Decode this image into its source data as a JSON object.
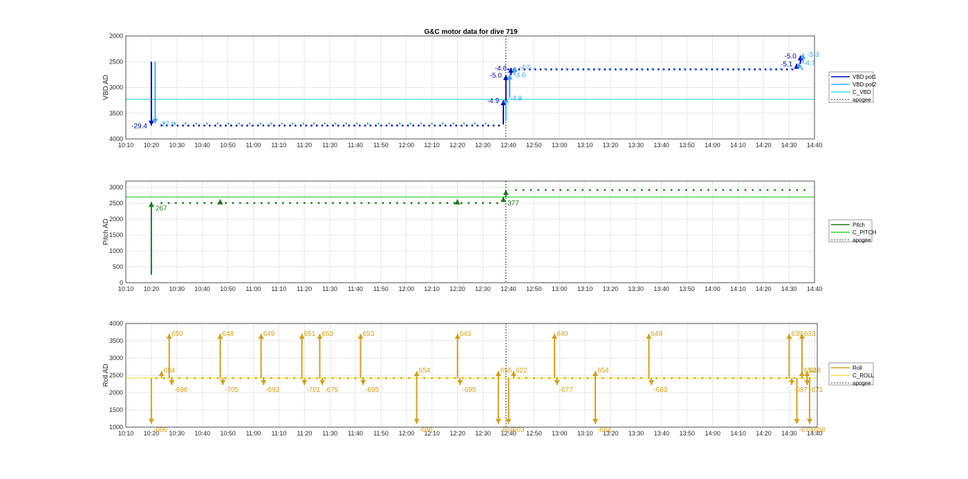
{
  "title": "G&C motor data for dive 719",
  "colors": {
    "vbd_pot1": "#0000c0",
    "vbd_pot2": "#3aa6ff",
    "c_vbd": "#33dddd",
    "pitch": "#1a7a1a",
    "c_pitch": "#33cc33",
    "roll": "#d4a017",
    "c_roll": "#f2e04a",
    "apogee": "#333333",
    "grid": "#e6e6e6",
    "axis": "#262626"
  },
  "chart_data": [
    {
      "type": "scatter",
      "name": "vbd",
      "title": "G&C motor data for dive 719",
      "xlabel": "",
      "ylabel": "VBD AD",
      "y_reversed": true,
      "xlim": [
        "10:10",
        "14:40"
      ],
      "xticks": [
        "10:10",
        "10:20",
        "10:30",
        "10:40",
        "10:50",
        "11:00",
        "11:10",
        "11:20",
        "11:30",
        "11:40",
        "11:50",
        "12:00",
        "12:10",
        "12:20",
        "12:30",
        "12:40",
        "12:50",
        "13:00",
        "13:10",
        "13:20",
        "13:30",
        "13:40",
        "13:50",
        "14:00",
        "14:10",
        "14:20",
        "14:30",
        "14:40"
      ],
      "ylim": [
        2000,
        4000
      ],
      "yticks": [
        "2000",
        "2500",
        "3000",
        "3500",
        "4000"
      ],
      "grid": true,
      "legend_position": "right",
      "legend": [
        "VBD pot1",
        "VBD pot2",
        "C_VBD",
        "apogee"
      ],
      "apogee": "12:39",
      "reference": {
        "name": "C_VBD",
        "value": 3230
      },
      "series": [
        {
          "name": "VBD pot1",
          "pre": {
            "start": "10:24",
            "end": "12:38",
            "step": 2.1,
            "value": 3740
          },
          "post": {
            "start": "12:40",
            "end": "14:32",
            "step": 2.1,
            "value": 2650
          }
        },
        {
          "name": "VBD pot2",
          "pre": {
            "start": "10:25",
            "end": "12:34",
            "step": 4.2,
            "value": 3700
          },
          "post": {
            "start": "12:46",
            "end": "14:36",
            "step": 4.2,
            "value": 2640
          }
        }
      ],
      "moves": [
        {
          "t": "10:20",
          "from": 2500,
          "to": 3740,
          "series": "VBD pot1",
          "label": "-29.4",
          "label_side": "left"
        },
        {
          "t": "10:21.5",
          "from": 2500,
          "to": 3700,
          "series": "VBD pot2",
          "label": "-27.9",
          "label_side": "right"
        },
        {
          "t": "12:38",
          "from": 3720,
          "to": 3250,
          "series": "VBD pot1",
          "label": "-4.9",
          "label_side": "left"
        },
        {
          "t": "12:39",
          "from": 3650,
          "to": 3200,
          "series": "VBD pot2",
          "label": "-4.9",
          "label_side": "right"
        },
        {
          "t": "12:39",
          "from": 3250,
          "to": 2760,
          "series": "VBD pot1",
          "label": "-5.0",
          "label_side": "left"
        },
        {
          "t": "12:40.5",
          "from": 3200,
          "to": 2750,
          "series": "VBD pot2",
          "label": "-4.6",
          "label_side": "right"
        },
        {
          "t": "12:41",
          "from": 2760,
          "to": 2620,
          "series": "VBD pot1",
          "label": "-4.6",
          "label_side": "left"
        },
        {
          "t": "12:42.5",
          "from": 2750,
          "to": 2600,
          "series": "VBD pot2",
          "label": "-4.6",
          "label_side": "right"
        },
        {
          "t": "14:33",
          "from": 2640,
          "to": 2540,
          "series": "VBD pot1",
          "label": "-5.1",
          "label_side": "left"
        },
        {
          "t": "14:34",
          "from": 2600,
          "to": 2520,
          "series": "VBD pot2",
          "label": "-4.7",
          "label_side": "right"
        },
        {
          "t": "14:34.5",
          "from": 2540,
          "to": 2380,
          "series": "VBD pot1",
          "label": "-5.0",
          "label_side": "left"
        },
        {
          "t": "14:35.5",
          "from": 2520,
          "to": 2350,
          "series": "VBD pot2",
          "label": "-5.3",
          "label_side": "right"
        }
      ]
    },
    {
      "type": "scatter",
      "name": "pitch",
      "xlabel": "",
      "ylabel": "Pitch AD",
      "xlim": [
        "10:10",
        "14:40"
      ],
      "xticks": [
        "10:10",
        "10:20",
        "10:30",
        "10:40",
        "10:50",
        "11:00",
        "11:10",
        "11:20",
        "11:30",
        "11:40",
        "11:50",
        "12:00",
        "12:10",
        "12:20",
        "12:30",
        "12:40",
        "12:50",
        "13:00",
        "13:10",
        "13:20",
        "13:30",
        "13:40",
        "13:50",
        "14:00",
        "14:10",
        "14:20",
        "14:30",
        "14:40"
      ],
      "ylim": [
        0,
        3200
      ],
      "yticks": [
        "0",
        "500",
        "1000",
        "1500",
        "2000",
        "2500",
        "3000"
      ],
      "grid": true,
      "legend_position": "right",
      "legend": [
        "Pitch",
        "C_PITCH",
        "apogee"
      ],
      "apogee": "12:39",
      "reference": {
        "name": "C_PITCH",
        "value": 2700
      },
      "series": [
        {
          "name": "Pitch",
          "pre": {
            "start": "10:24",
            "end": "12:36",
            "step": 2.8,
            "value": 2510
          },
          "post": {
            "start": "12:43",
            "end": "14:38",
            "step": 2.9,
            "value": 2920
          }
        }
      ],
      "moves": [
        {
          "t": "10:20",
          "from": 250,
          "to": 2540,
          "label": "267",
          "label_side": "right"
        },
        {
          "t": "12:38",
          "from": 2540,
          "to": 2700,
          "label": "377",
          "label_side": "right"
        },
        {
          "t": "12:39",
          "from": 2700,
          "to": 2920,
          "label": "",
          "label_side": "right"
        }
      ],
      "markers": [
        {
          "t": "10:47",
          "value": 2530
        },
        {
          "t": "12:20",
          "value": 2530
        }
      ]
    },
    {
      "type": "scatter",
      "name": "roll",
      "xlabel": "",
      "ylabel": "Roll AD",
      "xlim": [
        "10:10",
        "14:41"
      ],
      "xticks": [
        "10:10",
        "10:20",
        "10:30",
        "10:40",
        "10:50",
        "11:00",
        "11:10",
        "11:20",
        "11:30",
        "11:40",
        "11:50",
        "12:00",
        "12:10",
        "12:20",
        "12:30",
        "12:40",
        "12:50",
        "13:00",
        "13:10",
        "13:20",
        "13:30",
        "13:40",
        "13:50",
        "14:00",
        "14:10",
        "14:20",
        "14:30",
        "14:40"
      ],
      "ylim": [
        1000,
        4000
      ],
      "yticks": [
        "1000",
        "1500",
        "2000",
        "2500",
        "3000",
        "3500",
        "4000"
      ],
      "grid": true,
      "legend_position": "right",
      "legend": [
        "Roll",
        "C_ROLL",
        "apogee"
      ],
      "apogee": "12:39",
      "reference": {
        "name": "C_ROLL",
        "value": 2420
      },
      "series": [
        {
          "name": "Roll",
          "pre": {
            "start": "10:22",
            "end": "12:36",
            "step": 3.0,
            "value": 2420
          },
          "post": {
            "start": "12:44",
            "end": "14:38",
            "step": 3.0,
            "value": 2420
          }
        }
      ],
      "spikes": [
        {
          "t": "10:20",
          "dir": "down",
          "label": "-606"
        },
        {
          "t": "10:24",
          "dir": "up_short",
          "label": "654"
        },
        {
          "t": "10:27",
          "dir": "up",
          "label": "650"
        },
        {
          "t": "10:28",
          "dir": "down_short",
          "label": "-696"
        },
        {
          "t": "10:47",
          "dir": "up",
          "label": "648"
        },
        {
          "t": "10:48",
          "dir": "down_short",
          "label": "-705"
        },
        {
          "t": "11:03",
          "dir": "up",
          "label": "649"
        },
        {
          "t": "11:04",
          "dir": "down_short",
          "label": "-693"
        },
        {
          "t": "11:19",
          "dir": "up",
          "label": "651"
        },
        {
          "t": "11:20",
          "dir": "down_short",
          "label": "-701"
        },
        {
          "t": "11:26",
          "dir": "up",
          "label": "653"
        },
        {
          "t": "11:27",
          "dir": "down_short",
          "label": "-679"
        },
        {
          "t": "11:42",
          "dir": "up",
          "label": "653"
        },
        {
          "t": "11:43",
          "dir": "down_short",
          "label": "-695"
        },
        {
          "t": "12:04",
          "dir": "up_short",
          "label": "654"
        },
        {
          "t": "12:04",
          "dir": "down",
          "label": "-686"
        },
        {
          "t": "12:20",
          "dir": "up",
          "label": "643"
        },
        {
          "t": "12:21",
          "dir": "down_short",
          "label": "-695"
        },
        {
          "t": "12:36",
          "dir": "up_short",
          "label": "656"
        },
        {
          "t": "12:36",
          "dir": "down",
          "label": "-659"
        },
        {
          "t": "12:40",
          "dir": "down",
          "label": "-603"
        },
        {
          "t": "12:42",
          "dir": "up_short",
          "label": "622"
        },
        {
          "t": "12:58",
          "dir": "up",
          "label": "640"
        },
        {
          "t": "12:59",
          "dir": "down_short",
          "label": "-677"
        },
        {
          "t": "13:14",
          "dir": "up_short",
          "label": "654"
        },
        {
          "t": "13:14",
          "dir": "down",
          "label": "-664"
        },
        {
          "t": "13:35",
          "dir": "up",
          "label": "649"
        },
        {
          "t": "13:36",
          "dir": "down_short",
          "label": "-683"
        },
        {
          "t": "14:30",
          "dir": "up",
          "label": "639"
        },
        {
          "t": "14:31",
          "dir": "down_short",
          "label": "-687"
        },
        {
          "t": "14:33",
          "dir": "down",
          "label": "-679"
        },
        {
          "t": "14:35",
          "dir": "up",
          "label": "633"
        },
        {
          "t": "14:35",
          "dir": "up_short",
          "label": "652"
        },
        {
          "t": "14:37",
          "dir": "down_short",
          "label": "-671"
        },
        {
          "t": "14:37",
          "dir": "up_short",
          "label": "648"
        },
        {
          "t": "14:38",
          "dir": "down",
          "label": "-658"
        }
      ]
    }
  ]
}
